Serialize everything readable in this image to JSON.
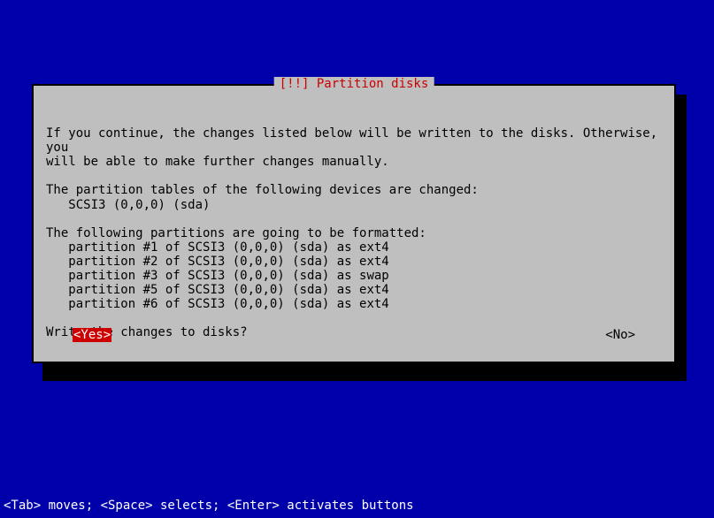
{
  "dialog": {
    "title": "[!!] Partition disks",
    "intro": "If you continue, the changes listed below will be written to the disks. Otherwise, you\nwill be able to make further changes manually.",
    "devices_heading": "The partition tables of the following devices are changed:",
    "devices": [
      "   SCSI3 (0,0,0) (sda)"
    ],
    "format_heading": "The following partitions are going to be formatted:",
    "partitions": [
      "   partition #1 of SCSI3 (0,0,0) (sda) as ext4",
      "   partition #2 of SCSI3 (0,0,0) (sda) as ext4",
      "   partition #3 of SCSI3 (0,0,0) (sda) as swap",
      "   partition #5 of SCSI3 (0,0,0) (sda) as ext4",
      "   partition #6 of SCSI3 (0,0,0) (sda) as ext4"
    ],
    "prompt": "Write the changes to disks?",
    "yes_label": "<Yes>",
    "no_label": "<No>"
  },
  "status": "<Tab> moves; <Space> selects; <Enter> activates buttons"
}
